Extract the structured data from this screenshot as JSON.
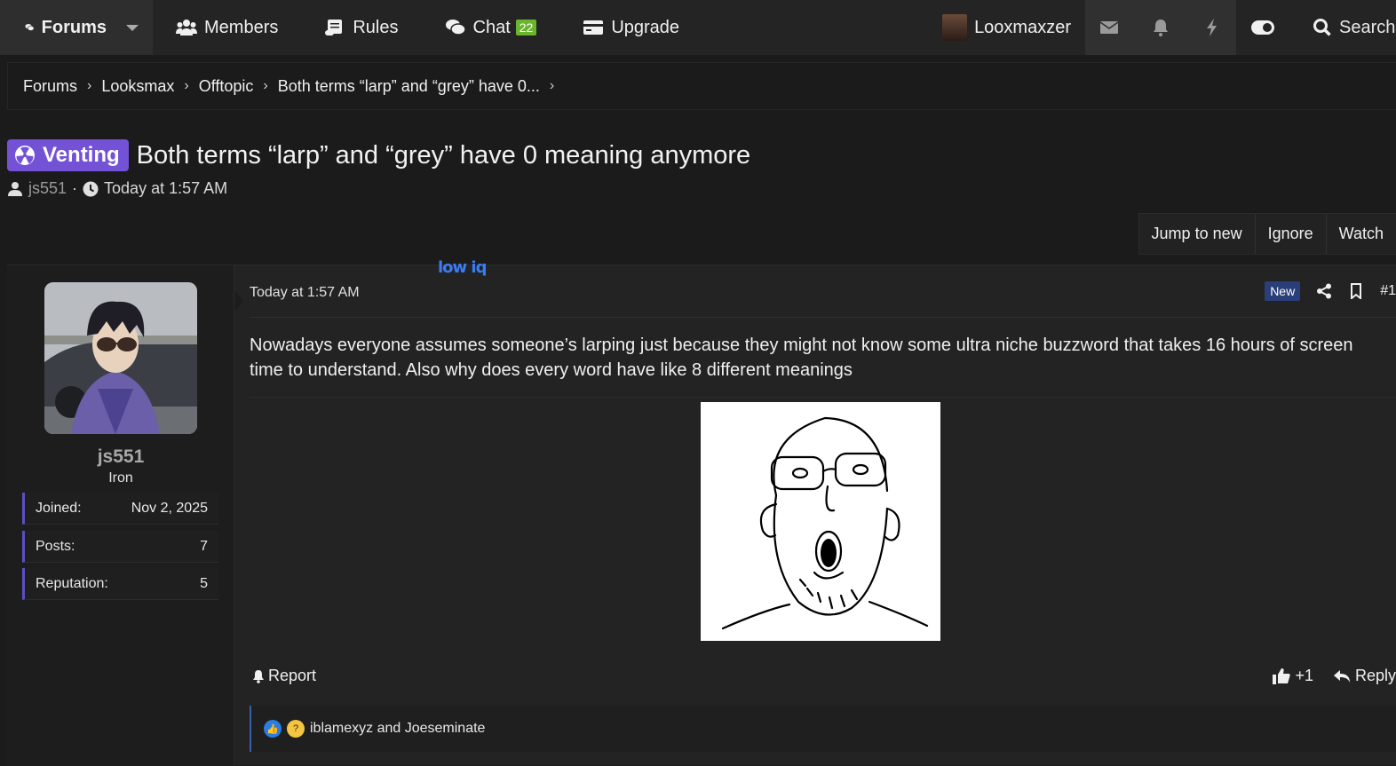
{
  "nav": {
    "forums": "Forums",
    "members": "Members",
    "rules": "Rules",
    "chat": "Chat",
    "chat_badge": "22",
    "upgrade": "Upgrade",
    "username": "Looxmaxzer",
    "search": "Search"
  },
  "breadcrumbs": [
    "Forums",
    "Looksmax",
    "Offtopic",
    "Both terms “larp” and “grey” have 0..."
  ],
  "thread": {
    "prefix": "Venting",
    "title": "Both terms “larp” and “grey” have 0 meaning anymore",
    "author": "js551",
    "date": "Today at 1:57 AM",
    "separator": "·"
  },
  "thread_buttons": [
    "Jump to new",
    "Ignore",
    "Watch"
  ],
  "post": {
    "overlay_text": "low iq",
    "time": "Today at 1:57 AM",
    "new_label": "New",
    "number": "#1",
    "body": "Nowadays everyone assumes someone’s larping just because they might not know some ultra niche buzzword that takes 16 hours of screen time to understand. Also why does every word have like 8 different meanings",
    "report": "Report",
    "like_count": "+1",
    "reply": "Reply",
    "reactions_text": "iblamexyz and Joeseminate"
  },
  "user": {
    "name": "js551",
    "title": "Iron",
    "stats": [
      {
        "label": "Joined:",
        "value": "Nov 2, 2025"
      },
      {
        "label": "Posts:",
        "value": "7"
      },
      {
        "label": "Reputation:",
        "value": "5"
      }
    ]
  },
  "colors": {
    "prefix_bg": "#7452d6",
    "badge_bg": "#6ab42e",
    "new_tag_bg": "#2a3f7a",
    "stat_accent": "#5b4fc4"
  }
}
